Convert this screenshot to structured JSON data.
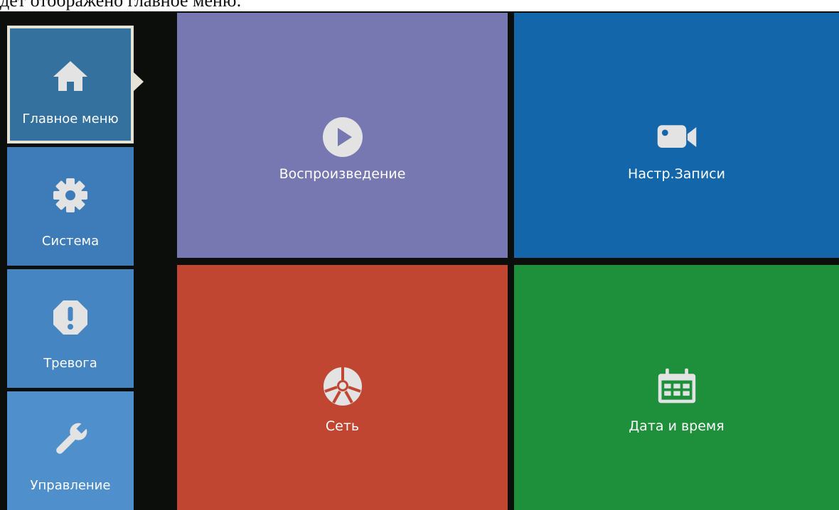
{
  "caption": "дет отображено главное меню:",
  "sidebar": {
    "items": [
      {
        "label": "Главное меню",
        "icon": "home-icon",
        "color": "#34719f",
        "selected": true
      },
      {
        "label": "Система",
        "icon": "gear-icon",
        "color": "#3d7cb8"
      },
      {
        "label": "Тревога",
        "icon": "alarm-icon",
        "color": "#4586c2"
      },
      {
        "label": "Управление",
        "icon": "wrench-icon",
        "color": "#4f90cc"
      }
    ]
  },
  "tiles": [
    {
      "label": "Воспроизведение",
      "icon": "play-icon",
      "color": "#7777b1"
    },
    {
      "label": "Настр.Записи",
      "icon": "video-camera-icon",
      "color": "#1366aa"
    },
    {
      "label": "Сеть",
      "icon": "network-icon",
      "color": "#c14632"
    },
    {
      "label": "Дата и время",
      "icon": "calendar-icon",
      "color": "#1e8f3a"
    }
  ],
  "colors": {
    "background": "#0c0e0c",
    "selection_border": "#e5e2d6",
    "icon": "#e3e3e3"
  }
}
